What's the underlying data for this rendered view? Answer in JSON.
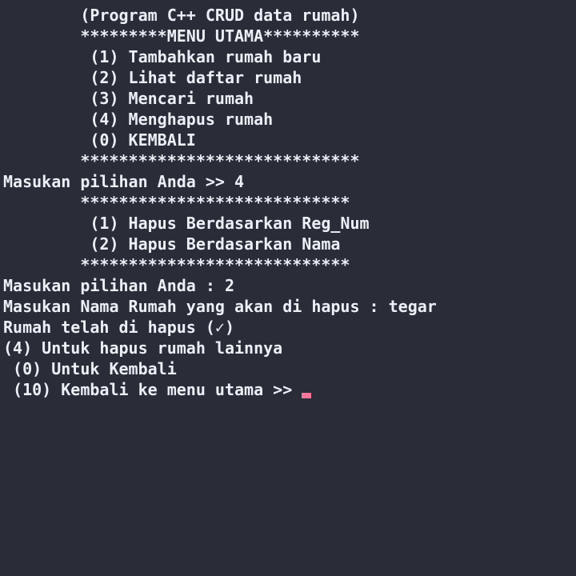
{
  "terminal": {
    "lines": [
      "        (Program C++ CRUD data rumah)",
      "        *********MENU UTAMA**********",
      "         (1) Tambahkan rumah baru",
      "         (2) Lihat daftar rumah",
      "         (3) Mencari rumah",
      "         (4) Menghapus rumah",
      "         (0) KEMBALI",
      "        *****************************",
      "Masukan pilihan Anda >> 4",
      "        ****************************",
      "         (1) Hapus Berdasarkan Reg_Num",
      "         (2) Hapus Berdasarkan Nama",
      "        ****************************",
      "Masukan pilihan Anda : 2",
      "Masukan Nama Rumah yang akan di hapus : tegar",
      "Rumah telah di hapus (✓)",
      "(4) Untuk hapus rumah lainnya",
      " (0) Untuk Kembali",
      " (10) Kembali ke menu utama >> "
    ],
    "cursor_color": "#f2779a",
    "background_color": "#2a2c38",
    "text_color": "#eceff4"
  }
}
